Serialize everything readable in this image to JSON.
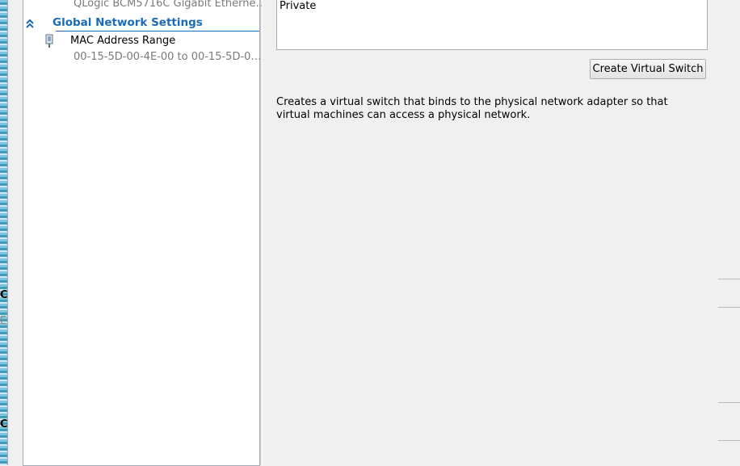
{
  "background": {
    "partial_text_1": "Cl",
    "partial_text_2": "E",
    "partial_text_3": "Cl"
  },
  "tree": {
    "adapter_description": "QLogic BCM5716C Gigabit Etherne…",
    "global_section": {
      "title": "Global Network Settings",
      "items": [
        {
          "label": "MAC Address Range",
          "detail": "00-15-5D-00-4E-00 to 00-15-5D-0…"
        }
      ]
    }
  },
  "switch_types": {
    "items": [
      "Private"
    ]
  },
  "create_button": "Create Virtual Switch",
  "description": "Creates a virtual switch that binds to the physical network adapter so that virtual machines can access a physical network.",
  "colors": {
    "accent": "#1a6bb8",
    "window_bg": "#f0f0f0"
  }
}
